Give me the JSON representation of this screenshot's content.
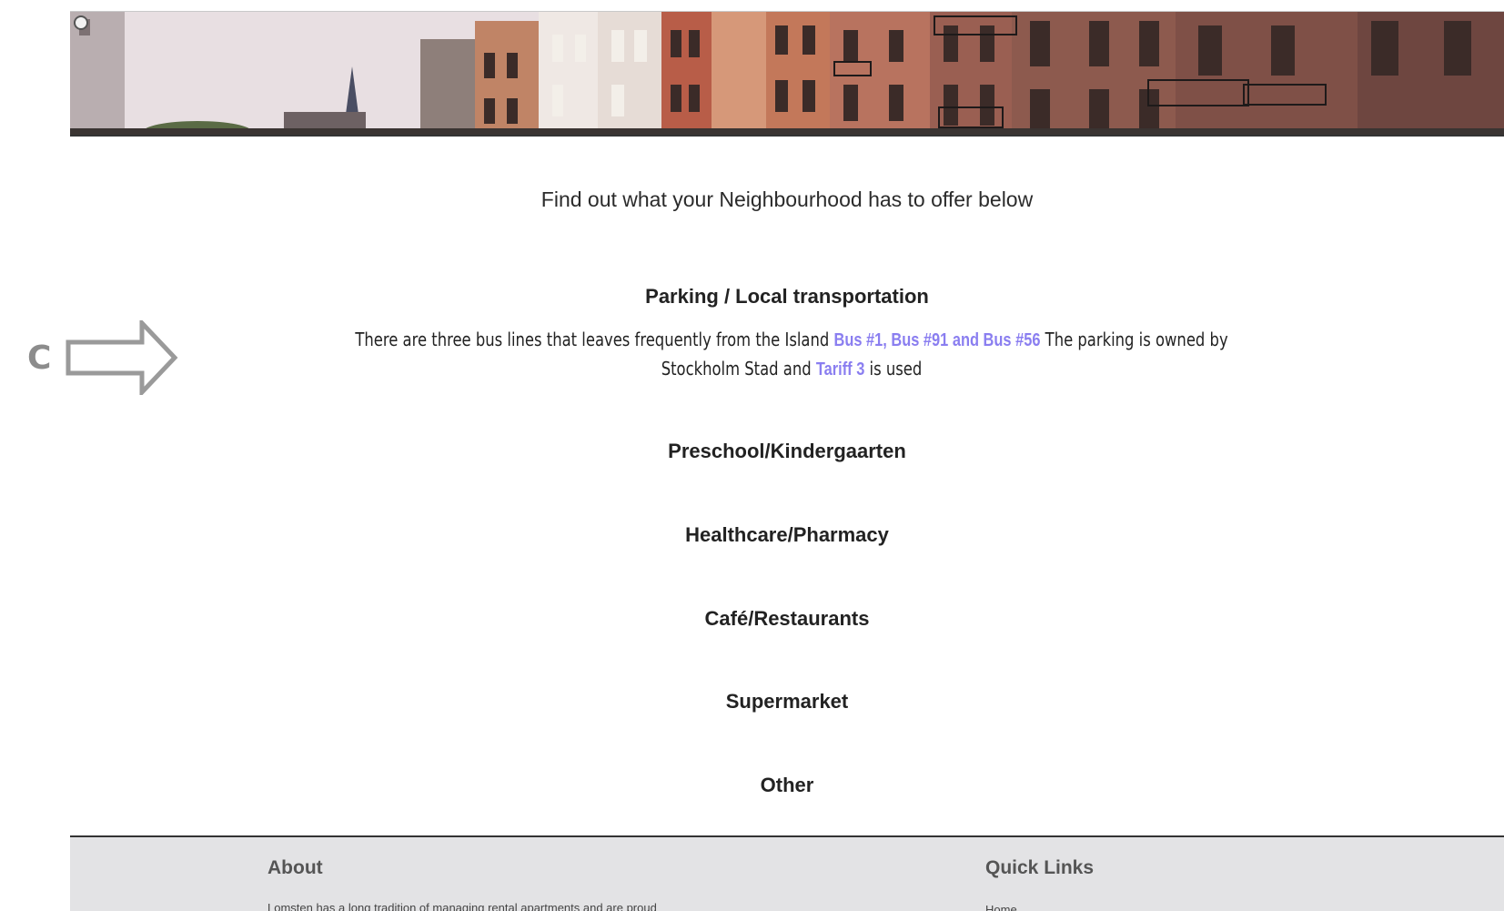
{
  "main": {
    "intro": "Find out what your Neighbourhood has to offer below",
    "sections": {
      "parking": "Parking / Local transportation",
      "preschool": "Preschool/Kindergaarten",
      "healthcare": "Healthcare/Pharmacy",
      "cafe": "Café/Restaurants",
      "supermarket": "Supermarket",
      "other": "Other"
    },
    "transport": {
      "text_before": "There are three bus lines that leaves frequently from the Island ",
      "bus_link": "Bus #1, Bus #91 and Bus #56",
      "text_middle": " The parking is owned by Stockholm Stad and ",
      "tariff_link": "Tariff 3",
      "text_after": " is used"
    },
    "link_color": "#8a7ef0"
  },
  "annotation": {
    "letter": "C",
    "color": "#8c8c8c"
  },
  "footer": {
    "about_heading": "About",
    "about_text": "Lomsten has a long tradition of managing rental apartments and are proud",
    "quick_links_heading": "Quick Links",
    "quick_links": [
      "Home"
    ],
    "background": "#e3e3e5"
  }
}
